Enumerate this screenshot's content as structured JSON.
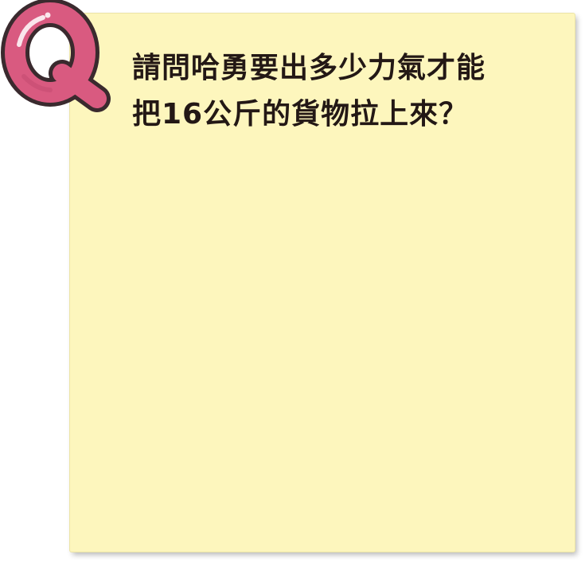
{
  "badge": {
    "letter": "Q",
    "fill_color": "#d95a80",
    "outline_color": "#3a2a2e"
  },
  "card": {
    "background": "#fdf6bd"
  },
  "question": {
    "line1": "請問哈勇要出多少力氣才能",
    "line2": "把16公斤的貨物拉上來？"
  }
}
